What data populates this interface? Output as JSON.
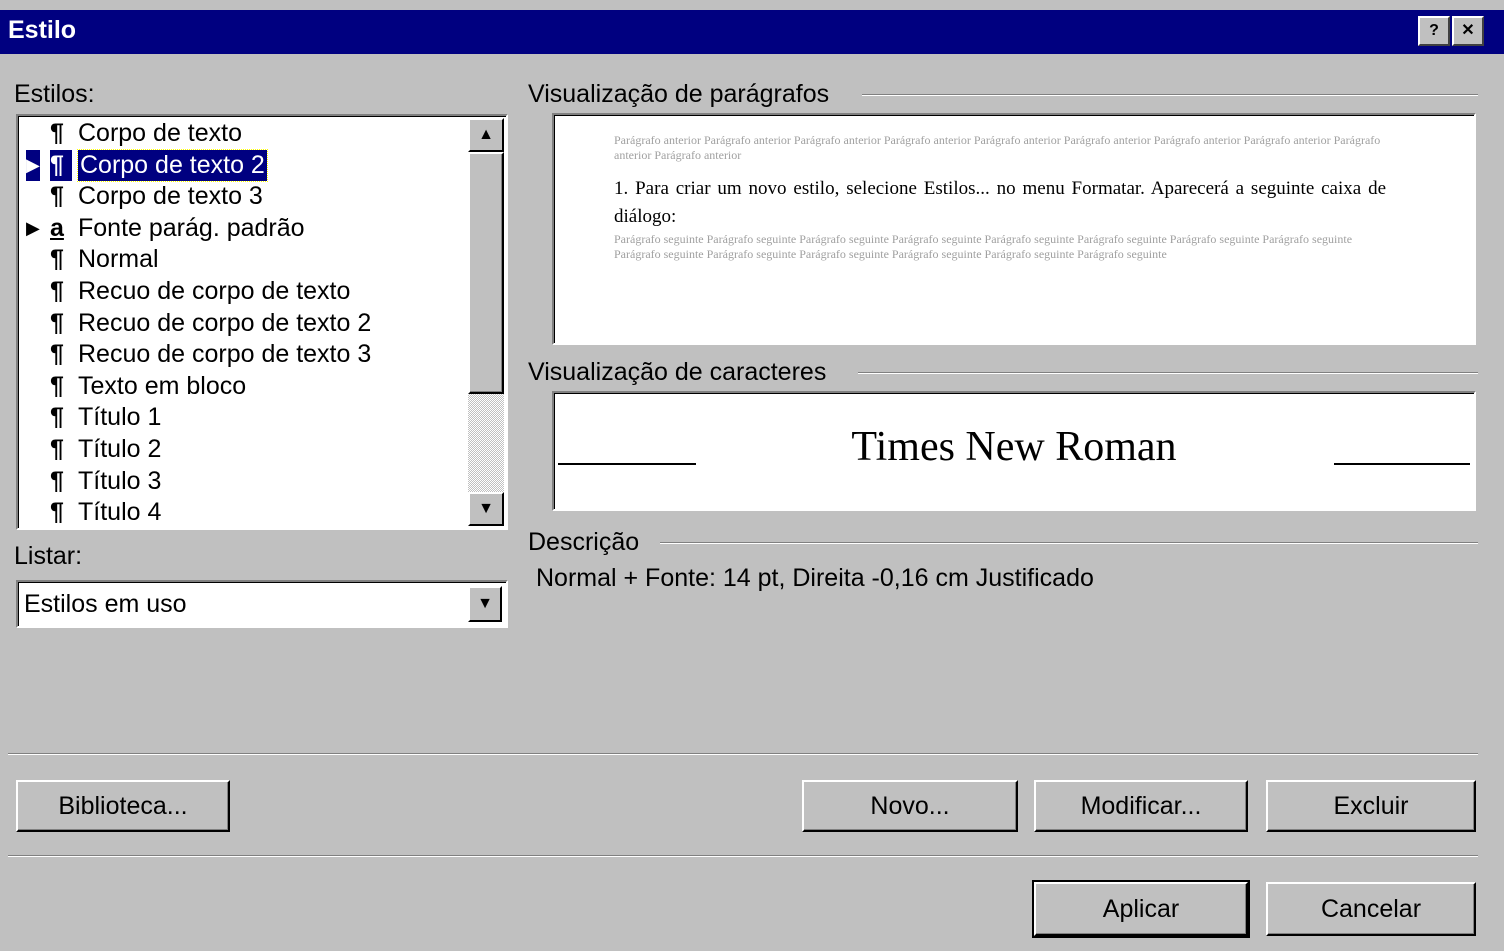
{
  "window": {
    "title": "Estilo",
    "help_label": "?",
    "close_label": "✕"
  },
  "styles_panel": {
    "label": "Estilos:",
    "items": [
      {
        "glyph": "¶",
        "marker": "",
        "label": "Corpo de texto"
      },
      {
        "glyph": "¶",
        "marker": "▶",
        "label": "Corpo de texto 2",
        "selected": true
      },
      {
        "glyph": "¶",
        "marker": "",
        "label": "Corpo de texto 3"
      },
      {
        "glyph": "a",
        "marker": "▶",
        "label": "Fonte parág. padrão"
      },
      {
        "glyph": "¶",
        "marker": "",
        "label": "Normal"
      },
      {
        "glyph": "¶",
        "marker": "",
        "label": "Recuo de corpo de texto"
      },
      {
        "glyph": "¶",
        "marker": "",
        "label": "Recuo de corpo de texto 2"
      },
      {
        "glyph": "¶",
        "marker": "",
        "label": "Recuo de corpo de texto 3"
      },
      {
        "glyph": "¶",
        "marker": "",
        "label": "Texto em bloco"
      },
      {
        "glyph": "¶",
        "marker": "",
        "label": "Título 1"
      },
      {
        "glyph": "¶",
        "marker": "",
        "label": "Título 2"
      },
      {
        "glyph": "¶",
        "marker": "",
        "label": "Título 3"
      },
      {
        "glyph": "¶",
        "marker": "",
        "label": "Título 4"
      }
    ]
  },
  "list_filter": {
    "label": "Listar:",
    "value": "Estilos em uso"
  },
  "paragraph_preview": {
    "label": "Visualização de parágrafos",
    "prev_text": "Parágrafo anterior Parágrafo anterior Parágrafo anterior Parágrafo anterior Parágrafo anterior Parágrafo anterior Parágrafo anterior Parágrafo anterior Parágrafo anterior Parágrafo anterior",
    "main_text": "1. Para criar um novo estilo, selecione Estilos... no menu Formatar. Aparecerá a seguinte caixa de diálogo:",
    "next_text": "Parágrafo seguinte Parágrafo seguinte Parágrafo seguinte Parágrafo seguinte Parágrafo seguinte Parágrafo seguinte Parágrafo seguinte Parágrafo seguinte Parágrafo seguinte Parágrafo seguinte Parágrafo seguinte Parágrafo seguinte Parágrafo seguinte Parágrafo seguinte"
  },
  "character_preview": {
    "label": "Visualização de caracteres",
    "font_name": "Times New Roman"
  },
  "description": {
    "label": "Descrição",
    "text": "Normal + Fonte: 14 pt, Direita  -0,16 cm Justificado"
  },
  "buttons": {
    "library": "Biblioteca...",
    "new": "Novo...",
    "modify": "Modificar...",
    "delete": "Excluir",
    "apply": "Aplicar",
    "cancel": "Cancelar"
  }
}
